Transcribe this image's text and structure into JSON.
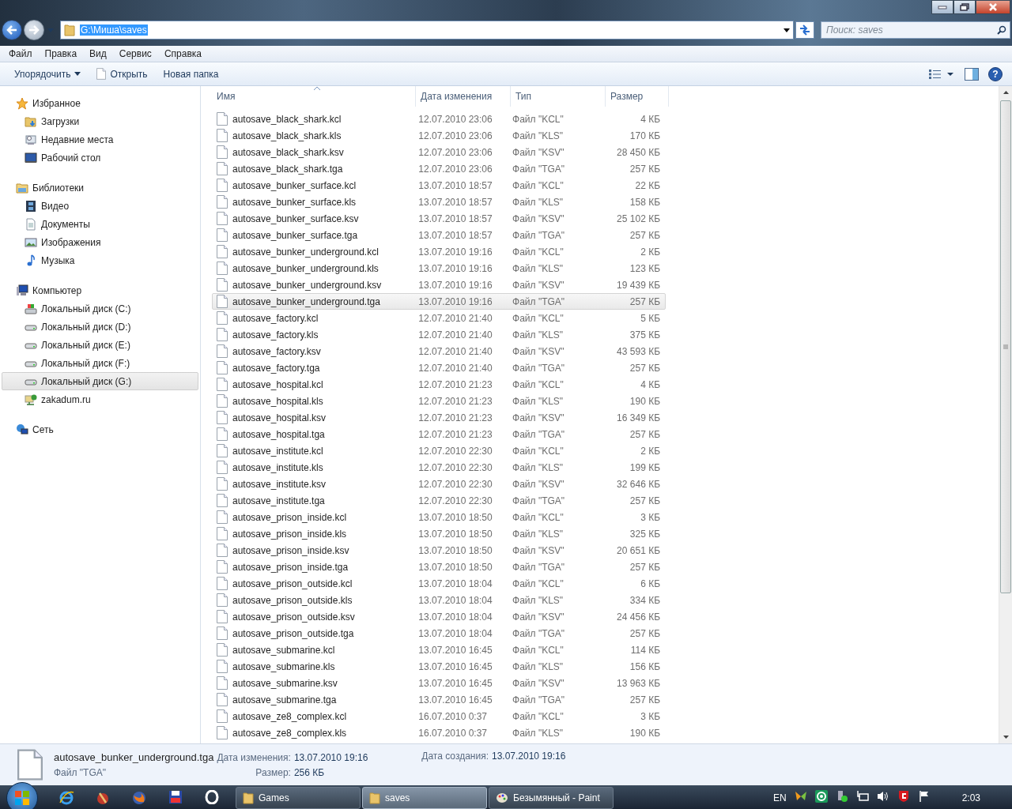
{
  "navigation": {
    "back": {
      "disabled": false
    },
    "forward": {
      "disabled": true
    }
  },
  "address_bar": {
    "path": "G:\\Миша\\saves",
    "path_selected": true
  },
  "search": {
    "placeholder": "Поиск: saves"
  },
  "menu": [
    "Файл",
    "Правка",
    "Вид",
    "Сервис",
    "Справка"
  ],
  "toolbar": {
    "buttons": [
      {
        "label": "Упорядочить",
        "kind": "dropdown"
      },
      {
        "label": "Открыть",
        "kind": "open"
      },
      {
        "label": "Новая папка",
        "kind": "plain"
      }
    ],
    "help": "?"
  },
  "sidebar": {
    "groups": [
      {
        "label": "Избранное",
        "kind": "star",
        "selected": false,
        "children": [
          {
            "label": "Загрузки",
            "kind": "downloads",
            "selected": false
          },
          {
            "label": "Недавние места",
            "kind": "recent",
            "selected": false
          },
          {
            "label": "Рабочий стол",
            "kind": "desktop",
            "selected": false
          }
        ]
      },
      {
        "label": "Библиотеки",
        "kind": "library",
        "selected": false,
        "children": [
          {
            "label": "Видео",
            "kind": "video",
            "selected": false
          },
          {
            "label": "Документы",
            "kind": "document",
            "selected": false
          },
          {
            "label": "Изображения",
            "kind": "pictures",
            "selected": false
          },
          {
            "label": "Музыка",
            "kind": "music",
            "selected": false
          }
        ]
      },
      {
        "label": "Компьютер",
        "kind": "computer",
        "selected": false,
        "children": [
          {
            "label": "Локальный диск (C:)",
            "kind": "system-drive",
            "selected": false
          },
          {
            "label": "Локальный диск (D:)",
            "kind": "drive",
            "selected": false
          },
          {
            "label": "Локальный диск (E:)",
            "kind": "drive",
            "selected": false
          },
          {
            "label": "Локальный диск (F:)",
            "kind": "drive",
            "selected": false
          },
          {
            "label": "Локальный диск (G:)",
            "kind": "drive",
            "selected": true
          },
          {
            "label": "zakadum.ru",
            "kind": "network-drive",
            "selected": false
          }
        ]
      },
      {
        "label": "Сеть",
        "kind": "network",
        "selected": false
      }
    ]
  },
  "file_list": {
    "columns": [
      {
        "label": "Имя",
        "sorted": true
      },
      {
        "label": "Дата изменения",
        "sorted": false
      },
      {
        "label": "Тип",
        "sorted": false
      },
      {
        "label": "Размер",
        "sorted": false
      }
    ],
    "rows": [
      {
        "name": "autosave_black_shark.kcl",
        "modified": "12.07.2010 23:06",
        "type": "Файл \"KCL\"",
        "size": "4 КБ",
        "selected": false
      },
      {
        "name": "autosave_black_shark.kls",
        "modified": "12.07.2010 23:06",
        "type": "Файл \"KLS\"",
        "size": "170 КБ",
        "selected": false
      },
      {
        "name": "autosave_black_shark.ksv",
        "modified": "12.07.2010 23:06",
        "type": "Файл \"KSV\"",
        "size": "28 450 КБ",
        "selected": false
      },
      {
        "name": "autosave_black_shark.tga",
        "modified": "12.07.2010 23:06",
        "type": "Файл \"TGA\"",
        "size": "257 КБ",
        "selected": false
      },
      {
        "name": "autosave_bunker_surface.kcl",
        "modified": "13.07.2010 18:57",
        "type": "Файл \"KCL\"",
        "size": "22 КБ",
        "selected": false
      },
      {
        "name": "autosave_bunker_surface.kls",
        "modified": "13.07.2010 18:57",
        "type": "Файл \"KLS\"",
        "size": "158 КБ",
        "selected": false
      },
      {
        "name": "autosave_bunker_surface.ksv",
        "modified": "13.07.2010 18:57",
        "type": "Файл \"KSV\"",
        "size": "25 102 КБ",
        "selected": false
      },
      {
        "name": "autosave_bunker_surface.tga",
        "modified": "13.07.2010 18:57",
        "type": "Файл \"TGA\"",
        "size": "257 КБ",
        "selected": false
      },
      {
        "name": "autosave_bunker_underground.kcl",
        "modified": "13.07.2010 19:16",
        "type": "Файл \"KCL\"",
        "size": "2 КБ",
        "selected": false
      },
      {
        "name": "autosave_bunker_underground.kls",
        "modified": "13.07.2010 19:16",
        "type": "Файл \"KLS\"",
        "size": "123 КБ",
        "selected": false
      },
      {
        "name": "autosave_bunker_underground.ksv",
        "modified": "13.07.2010 19:16",
        "type": "Файл \"KSV\"",
        "size": "19 439 КБ",
        "selected": false
      },
      {
        "name": "autosave_bunker_underground.tga",
        "modified": "13.07.2010 19:16",
        "type": "Файл \"TGA\"",
        "size": "257 КБ",
        "selected": true
      },
      {
        "name": "autosave_factory.kcl",
        "modified": "12.07.2010 21:40",
        "type": "Файл \"KCL\"",
        "size": "5 КБ",
        "selected": false
      },
      {
        "name": "autosave_factory.kls",
        "modified": "12.07.2010 21:40",
        "type": "Файл \"KLS\"",
        "size": "375 КБ",
        "selected": false
      },
      {
        "name": "autosave_factory.ksv",
        "modified": "12.07.2010 21:40",
        "type": "Файл \"KSV\"",
        "size": "43 593 КБ",
        "selected": false
      },
      {
        "name": "autosave_factory.tga",
        "modified": "12.07.2010 21:40",
        "type": "Файл \"TGA\"",
        "size": "257 КБ",
        "selected": false
      },
      {
        "name": "autosave_hospital.kcl",
        "modified": "12.07.2010 21:23",
        "type": "Файл \"KCL\"",
        "size": "4 КБ",
        "selected": false
      },
      {
        "name": "autosave_hospital.kls",
        "modified": "12.07.2010 21:23",
        "type": "Файл \"KLS\"",
        "size": "190 КБ",
        "selected": false
      },
      {
        "name": "autosave_hospital.ksv",
        "modified": "12.07.2010 21:23",
        "type": "Файл \"KSV\"",
        "size": "16 349 КБ",
        "selected": false
      },
      {
        "name": "autosave_hospital.tga",
        "modified": "12.07.2010 21:23",
        "type": "Файл \"TGA\"",
        "size": "257 КБ",
        "selected": false
      },
      {
        "name": "autosave_institute.kcl",
        "modified": "12.07.2010 22:30",
        "type": "Файл \"KCL\"",
        "size": "2 КБ",
        "selected": false
      },
      {
        "name": "autosave_institute.kls",
        "modified": "12.07.2010 22:30",
        "type": "Файл \"KLS\"",
        "size": "199 КБ",
        "selected": false
      },
      {
        "name": "autosave_institute.ksv",
        "modified": "12.07.2010 22:30",
        "type": "Файл \"KSV\"",
        "size": "32 646 КБ",
        "selected": false
      },
      {
        "name": "autosave_institute.tga",
        "modified": "12.07.2010 22:30",
        "type": "Файл \"TGA\"",
        "size": "257 КБ",
        "selected": false
      },
      {
        "name": "autosave_prison_inside.kcl",
        "modified": "13.07.2010 18:50",
        "type": "Файл \"KCL\"",
        "size": "3 КБ",
        "selected": false
      },
      {
        "name": "autosave_prison_inside.kls",
        "modified": "13.07.2010 18:50",
        "type": "Файл \"KLS\"",
        "size": "325 КБ",
        "selected": false
      },
      {
        "name": "autosave_prison_inside.ksv",
        "modified": "13.07.2010 18:50",
        "type": "Файл \"KSV\"",
        "size": "20 651 КБ",
        "selected": false
      },
      {
        "name": "autosave_prison_inside.tga",
        "modified": "13.07.2010 18:50",
        "type": "Файл \"TGA\"",
        "size": "257 КБ",
        "selected": false
      },
      {
        "name": "autosave_prison_outside.kcl",
        "modified": "13.07.2010 18:04",
        "type": "Файл \"KCL\"",
        "size": "6 КБ",
        "selected": false
      },
      {
        "name": "autosave_prison_outside.kls",
        "modified": "13.07.2010 18:04",
        "type": "Файл \"KLS\"",
        "size": "334 КБ",
        "selected": false
      },
      {
        "name": "autosave_prison_outside.ksv",
        "modified": "13.07.2010 18:04",
        "type": "Файл \"KSV\"",
        "size": "24 456 КБ",
        "selected": false
      },
      {
        "name": "autosave_prison_outside.tga",
        "modified": "13.07.2010 18:04",
        "type": "Файл \"TGA\"",
        "size": "257 КБ",
        "selected": false
      },
      {
        "name": "autosave_submarine.kcl",
        "modified": "13.07.2010 16:45",
        "type": "Файл \"KCL\"",
        "size": "114 КБ",
        "selected": false
      },
      {
        "name": "autosave_submarine.kls",
        "modified": "13.07.2010 16:45",
        "type": "Файл \"KLS\"",
        "size": "156 КБ",
        "selected": false
      },
      {
        "name": "autosave_submarine.ksv",
        "modified": "13.07.2010 16:45",
        "type": "Файл \"KSV\"",
        "size": "13 963 КБ",
        "selected": false
      },
      {
        "name": "autosave_submarine.tga",
        "modified": "13.07.2010 16:45",
        "type": "Файл \"TGA\"",
        "size": "257 КБ",
        "selected": false
      },
      {
        "name": "autosave_ze8_complex.kcl",
        "modified": "16.07.2010 0:37",
        "type": "Файл \"KCL\"",
        "size": "3 КБ",
        "selected": false
      },
      {
        "name": "autosave_ze8_complex.kls",
        "modified": "16.07.2010 0:37",
        "type": "Файл \"KLS\"",
        "size": "190 КБ",
        "selected": false
      }
    ]
  },
  "details": {
    "name": "autosave_bunker_underground.tga",
    "type": "Файл \"TGA\"",
    "fields": [
      {
        "label": "Дата изменения:",
        "value": "13.07.2010 19:16"
      },
      {
        "label": "Размер:",
        "value": "256 КБ"
      },
      {
        "label": "Дата создания:",
        "value": "13.07.2010 19:16"
      }
    ]
  },
  "taskbar": {
    "tasks": [
      {
        "label": "Games",
        "kind": "folder",
        "selected": false
      },
      {
        "label": "saves",
        "kind": "folder",
        "selected": true
      },
      {
        "label": "Безымянный - Paint",
        "kind": "paint",
        "selected": false
      }
    ],
    "language": "EN",
    "clock": "2:03"
  }
}
